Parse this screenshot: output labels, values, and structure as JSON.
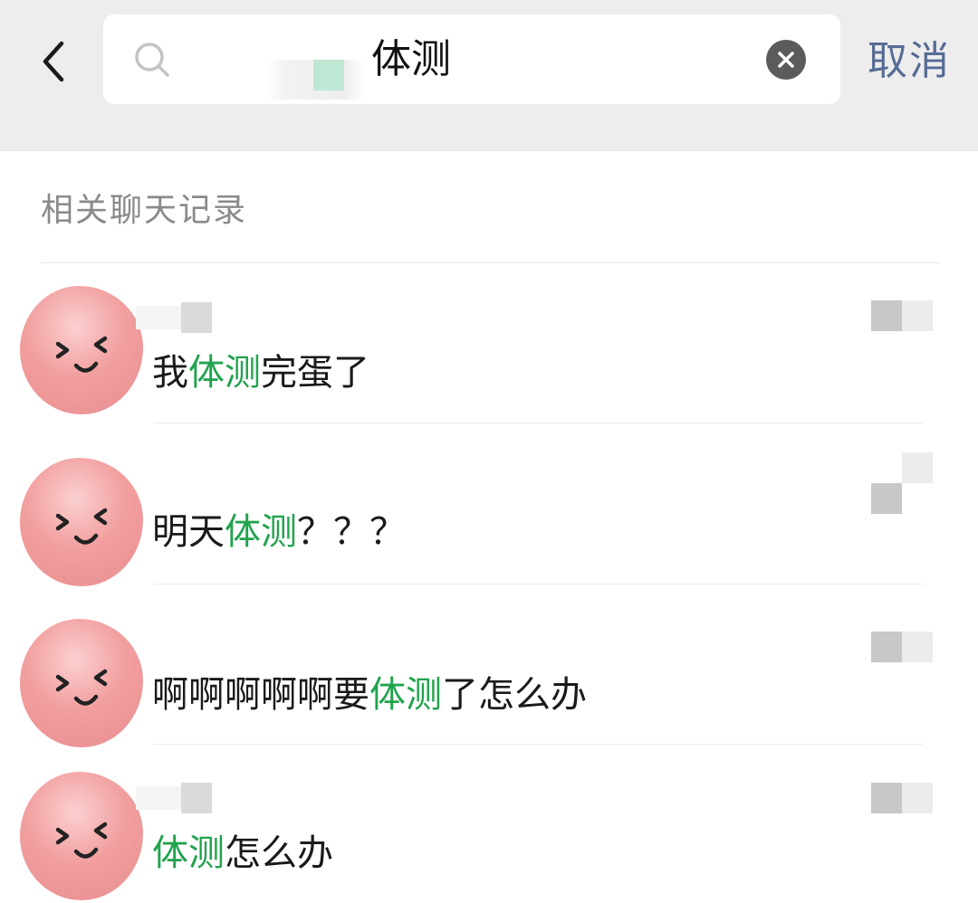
{
  "header": {
    "search_query": "体测",
    "cancel_label": "取消"
  },
  "section": {
    "title": "相关聊天记录"
  },
  "results": [
    {
      "before": "我",
      "highlight": "体测",
      "after": "完蛋了"
    },
    {
      "before": "明天",
      "highlight": "体测",
      "after": "？？？"
    },
    {
      "before": "啊啊啊啊啊要",
      "highlight": "体测",
      "after": "了怎么办"
    },
    {
      "before": "",
      "highlight": "体测",
      "after": "怎么办"
    }
  ],
  "colors": {
    "highlight": "#21a34e",
    "cancel": "#576b95",
    "header_bg": "#ededed",
    "avatar": "#f0a0a3"
  },
  "icons": {
    "back": "chevron-left-icon",
    "search": "search-icon",
    "clear": "clear-x-icon",
    "avatar_face": "smiling-face-icon"
  }
}
